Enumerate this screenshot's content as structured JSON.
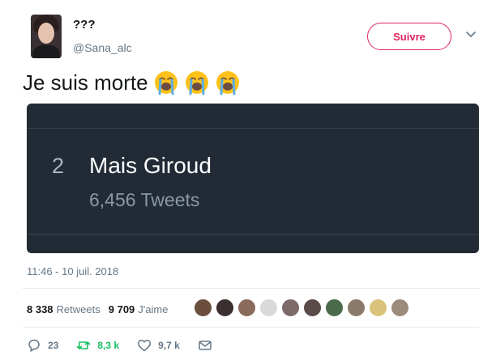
{
  "user": {
    "display_name": "???",
    "handle": "@Sana_alc",
    "follow_label": "Suivre"
  },
  "tweet": {
    "text": "Je suis morte",
    "emoji": [
      "loudly-crying-face",
      "loudly-crying-face",
      "loudly-crying-face"
    ],
    "timestamp": "11:46 - 10 juil. 2018"
  },
  "media": {
    "rank": "2",
    "trend_name": "Mais Giroud",
    "trend_count": "6,456 Tweets"
  },
  "stats": {
    "retweets_count": "8 338",
    "retweets_label": "Retweets",
    "likes_count": "9 709",
    "likes_label": "J'aime"
  },
  "likers": {
    "colors": [
      "#6b4e3d",
      "#3b2f2f",
      "#8a6a5a",
      "#d9d9d9",
      "#7d6b6b",
      "#5a4a4a",
      "#4a6b4a",
      "#8a7a6a",
      "#d9c27a",
      "#9b8b7b"
    ]
  },
  "actions": {
    "replies": "23",
    "retweets": "8,3 k",
    "likes": "9,7 k"
  },
  "colors": {
    "follow_accent": "#e0245e",
    "retweet_green": "#17bf63",
    "muted_text": "#657786",
    "media_bg": "#222a35"
  }
}
